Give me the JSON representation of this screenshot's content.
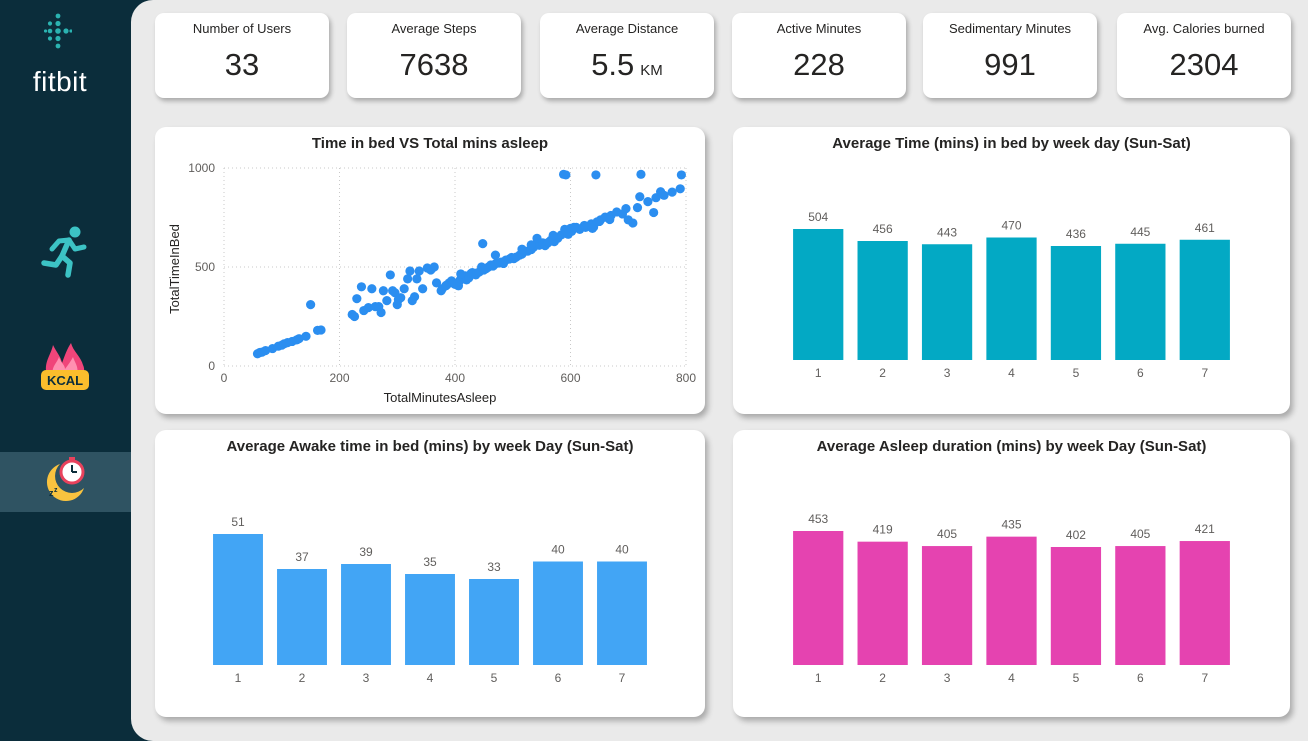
{
  "brand": {
    "name": "fitbit"
  },
  "nav": [
    {
      "icon": "running-person-icon"
    },
    {
      "icon": "kcal-flame-icon",
      "badge": "KCAL"
    },
    {
      "icon": "sleep-timer-icon",
      "active": true
    }
  ],
  "kpis": [
    {
      "label": "Number of Users",
      "value": "33",
      "unit": ""
    },
    {
      "label": "Average Steps",
      "value": "7638",
      "unit": ""
    },
    {
      "label": "Average Distance",
      "value": "5.5",
      "unit": "KM"
    },
    {
      "label": "Active Minutes",
      "value": "228",
      "unit": ""
    },
    {
      "label": "Sedimentary Minutes",
      "value": "991",
      "unit": ""
    },
    {
      "label": "Avg. Calories burned",
      "value": "2304",
      "unit": ""
    }
  ],
  "chart_data": [
    {
      "type": "scatter",
      "title": "Time in bed VS Total mins asleep",
      "xlabel": "TotalMinutesAsleep",
      "ylabel": "TotalTimeInBed",
      "xlim": [
        0,
        800
      ],
      "ylim": [
        0,
        1000
      ],
      "xticks": [
        "0",
        "200",
        "400",
        "600",
        "800"
      ],
      "yticks": [
        "0",
        "500",
        "1000"
      ],
      "grid": true,
      "color": "#2b8ef0",
      "points": [
        [
          58,
          62
        ],
        [
          62,
          68
        ],
        [
          66,
          70
        ],
        [
          72,
          78
        ],
        [
          84,
          88
        ],
        [
          94,
          100
        ],
        [
          100,
          105
        ],
        [
          104,
          112
        ],
        [
          110,
          118
        ],
        [
          118,
          124
        ],
        [
          126,
          132
        ],
        [
          130,
          138
        ],
        [
          142,
          150
        ],
        [
          150,
          310
        ],
        [
          162,
          180
        ],
        [
          168,
          182
        ],
        [
          222,
          260
        ],
        [
          226,
          250
        ],
        [
          230,
          340
        ],
        [
          238,
          400
        ],
        [
          242,
          280
        ],
        [
          250,
          295
        ],
        [
          256,
          390
        ],
        [
          262,
          300
        ],
        [
          268,
          300
        ],
        [
          272,
          270
        ],
        [
          276,
          380
        ],
        [
          282,
          330
        ],
        [
          288,
          460
        ],
        [
          292,
          380
        ],
        [
          296,
          370
        ],
        [
          300,
          310
        ],
        [
          302,
          335
        ],
        [
          306,
          345
        ],
        [
          312,
          390
        ],
        [
          318,
          440
        ],
        [
          322,
          480
        ],
        [
          326,
          330
        ],
        [
          330,
          350
        ],
        [
          334,
          440
        ],
        [
          338,
          480
        ],
        [
          344,
          390
        ],
        [
          352,
          495
        ],
        [
          358,
          485
        ],
        [
          364,
          500
        ],
        [
          368,
          420
        ],
        [
          376,
          380
        ],
        [
          378,
          390
        ],
        [
          384,
          405
        ],
        [
          386,
          410
        ],
        [
          390,
          420
        ],
        [
          394,
          430
        ],
        [
          396,
          420
        ],
        [
          400,
          412
        ],
        [
          406,
          405
        ],
        [
          408,
          430
        ],
        [
          410,
          440
        ],
        [
          414,
          448
        ],
        [
          418,
          455
        ],
        [
          420,
          435
        ],
        [
          424,
          445
        ],
        [
          428,
          468
        ],
        [
          430,
          472
        ],
        [
          436,
          460
        ],
        [
          438,
          470
        ],
        [
          442,
          475
        ],
        [
          446,
          500
        ],
        [
          450,
          485
        ],
        [
          454,
          492
        ],
        [
          458,
          500
        ],
        [
          462,
          510
        ],
        [
          466,
          505
        ],
        [
          470,
          516
        ],
        [
          476,
          520
        ],
        [
          480,
          525
        ],
        [
          484,
          518
        ],
        [
          488,
          535
        ],
        [
          494,
          540
        ],
        [
          498,
          548
        ],
        [
          502,
          542
        ],
        [
          506,
          550
        ],
        [
          512,
          560
        ],
        [
          516,
          565
        ],
        [
          520,
          578
        ],
        [
          526,
          580
        ],
        [
          532,
          588
        ],
        [
          536,
          600
        ],
        [
          540,
          615
        ],
        [
          546,
          610
        ],
        [
          552,
          622
        ],
        [
          556,
          608
        ],
        [
          560,
          620
        ],
        [
          566,
          635
        ],
        [
          572,
          628
        ],
        [
          578,
          645
        ],
        [
          584,
          662
        ],
        [
          590,
          690
        ],
        [
          596,
          665
        ],
        [
          602,
          680
        ],
        [
          610,
          700
        ],
        [
          616,
          690
        ],
        [
          624,
          710
        ],
        [
          636,
          718
        ],
        [
          640,
          702
        ],
        [
          646,
          728
        ],
        [
          652,
          738
        ],
        [
          660,
          752
        ],
        [
          670,
          760
        ],
        [
          680,
          778
        ],
        [
          696,
          795
        ],
        [
          716,
          800
        ],
        [
          734,
          830
        ],
        [
          748,
          850
        ],
        [
          762,
          862
        ],
        [
          776,
          878
        ],
        [
          790,
          895
        ],
        [
          410,
          465
        ],
        [
          448,
          618
        ],
        [
          470,
          560
        ],
        [
          516,
          590
        ],
        [
          532,
          612
        ],
        [
          542,
          645
        ],
        [
          562,
          625
        ],
        [
          570,
          660
        ],
        [
          588,
          968
        ],
        [
          600,
          695
        ],
        [
          606,
          700
        ],
        [
          626,
          700
        ],
        [
          638,
          695
        ],
        [
          650,
          730
        ],
        [
          668,
          740
        ],
        [
          690,
          768
        ],
        [
          700,
          738
        ],
        [
          708,
          722
        ],
        [
          720,
          855
        ],
        [
          744,
          775
        ],
        [
          756,
          880
        ],
        [
          592,
          965
        ],
        [
          644,
          965
        ],
        [
          722,
          968
        ],
        [
          792,
          965
        ]
      ]
    },
    {
      "type": "bar",
      "title": "Average Time (mins) in bed by week day (Sun-Sat)",
      "categories": [
        "1",
        "2",
        "3",
        "4",
        "5",
        "6",
        "7"
      ],
      "values": [
        504,
        456,
        443,
        470,
        436,
        445,
        461
      ],
      "color": "#03a9c4",
      "ylim": [
        0,
        504
      ]
    },
    {
      "type": "bar",
      "title": "Average Awake time in bed (mins) by week Day (Sun-Sat)",
      "categories": [
        "1",
        "2",
        "3",
        "4",
        "5",
        "6",
        "7"
      ],
      "values": [
        51,
        37,
        39,
        35,
        33,
        40,
        40
      ],
      "color": "#42a5f5",
      "ylim": [
        0,
        51
      ]
    },
    {
      "type": "bar",
      "title": "Average Asleep duration (mins) by week Day (Sun-Sat)",
      "categories": [
        "1",
        "2",
        "3",
        "4",
        "5",
        "6",
        "7"
      ],
      "values": [
        453,
        419,
        405,
        435,
        402,
        405,
        421
      ],
      "color": "#e543b0",
      "ylim": [
        0,
        453
      ]
    }
  ]
}
